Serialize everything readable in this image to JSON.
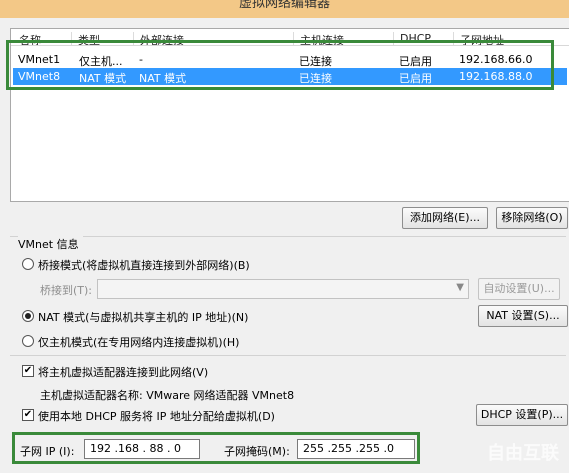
{
  "window": {
    "title": "虚拟网络编辑器"
  },
  "table": {
    "columns": [
      "名称",
      "类型",
      "外部连接",
      "主机连接",
      "DHCP",
      "子网地址"
    ],
    "rows": [
      {
        "name": "VMnet1",
        "type": "仅主机...",
        "external": "-",
        "host": "已连接",
        "dhcp": "已启用",
        "subnet": "192.168.66.0"
      },
      {
        "name": "VMnet8",
        "type": "NAT 模式",
        "external": "NAT 模式",
        "host": "已连接",
        "dhcp": "已启用",
        "subnet": "192.168.88.0"
      }
    ]
  },
  "buttons": {
    "add_network": "添加网络(E)...",
    "remove_network": "移除网络(O)",
    "auto_settings": "自动设置(U)...",
    "nat_settings": "NAT 设置(S)...",
    "dhcp_settings": "DHCP 设置(P)..."
  },
  "vmnet_info": {
    "group_label": "VMnet 信息",
    "bridged": "桥接模式(将虚拟机直接连接到外部网络)(B)",
    "bridged_to": "桥接到(T):",
    "nat": "NAT 模式(与虚拟机共享主机的 IP 地址)(N)",
    "host_only": "仅主机模式(在专用网络内连接虚拟机)(H)",
    "connect_adapter": "将主机虚拟适配器连接到此网络(V)",
    "adapter_name": "主机虚拟适配器名称: VMware 网络适配器 VMnet8",
    "use_dhcp": "使用本地 DHCP 服务将 IP 地址分配给虚拟机(D)",
    "subnet_ip_label": "子网 IP (I):",
    "subnet_ip": "192 .168 . 88  .  0",
    "subnet_mask_label": "子网掩码(M):",
    "subnet_mask": "255 .255 .255 .0"
  },
  "watermark": "自由互联"
}
